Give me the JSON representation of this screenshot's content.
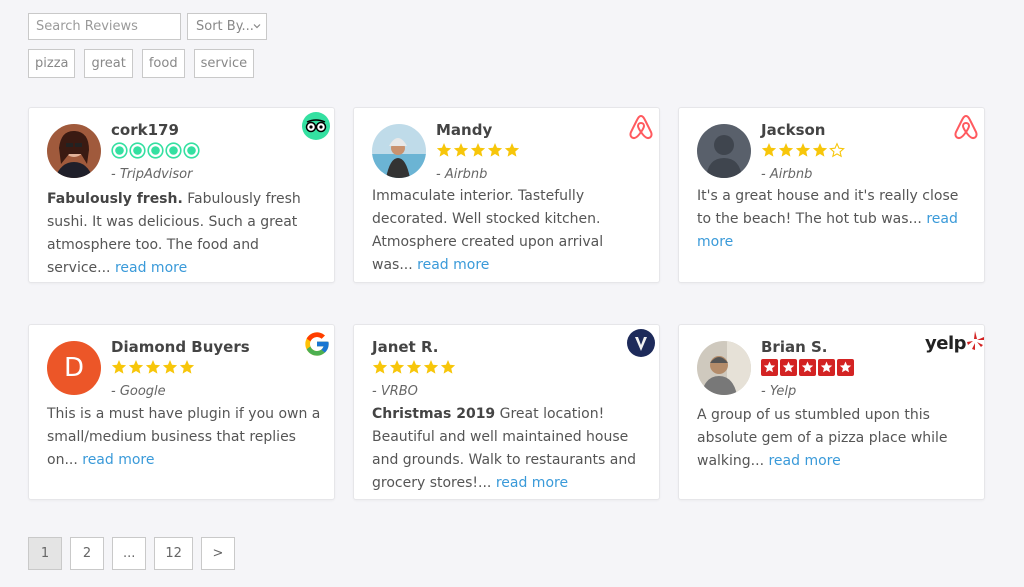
{
  "search": {
    "placeholder": "Search Reviews"
  },
  "sort": {
    "label": "Sort By..."
  },
  "tags": [
    "pizza",
    "great",
    "food",
    "service"
  ],
  "colors": {
    "star_gold": "#f7c60a",
    "tripadvisor": "#34e0a1",
    "airbnb": "#ff5a5f",
    "google_d": "#ec5628",
    "yelp": "#d32323",
    "link": "#3a9ad9"
  },
  "read_more": "read more",
  "reviews": [
    {
      "name": "cork179",
      "source": "- TripAdvisor",
      "rating": 5,
      "star_style": "tripadvisor",
      "bold": "Fabulously fresh.",
      "text": " Fabulously fresh sushi. It was delicious. Such a great atmosphere too. The food and service...",
      "logo": "tripadvisor-logo-icon"
    },
    {
      "name": "Mandy",
      "source": "- Airbnb",
      "rating": 5,
      "star_style": "gold",
      "bold": "",
      "text": "Immaculate interior. Tastefully decorated. Well stocked kitchen. Atmosphere created upon arrival was...",
      "logo": "airbnb-logo-icon"
    },
    {
      "name": "Jackson",
      "source": "- Airbnb",
      "rating": 4,
      "star_style": "gold",
      "bold": "",
      "text": "It's a great house and it's really close to the beach! The hot tub was...",
      "logo": "airbnb-logo-icon"
    },
    {
      "name": "Diamond Buyers",
      "source": "- Google",
      "rating": 5,
      "star_style": "gold",
      "bold": "",
      "text": "This is a must have plugin if you own a small/medium business that replies on...",
      "logo": "google-logo-icon",
      "initial": "D"
    },
    {
      "name": "Janet R.",
      "source": "- VRBO",
      "rating": 5,
      "star_style": "gold",
      "bold": "Christmas 2019",
      "text": " Great location! Beautiful and well maintained house and grounds. Walk to restaurants and grocery stores!...",
      "logo": "vrbo-logo-icon"
    },
    {
      "name": "Brian S.",
      "source": "- Yelp",
      "rating": 5,
      "star_style": "yelp",
      "bold": "",
      "text": "A group of us stumbled upon this absolute gem of a pizza place while walking...",
      "logo": "yelp-logo-icon",
      "logo_text": "yelp"
    }
  ],
  "pagination": [
    "1",
    "2",
    "...",
    "12",
    ">"
  ]
}
